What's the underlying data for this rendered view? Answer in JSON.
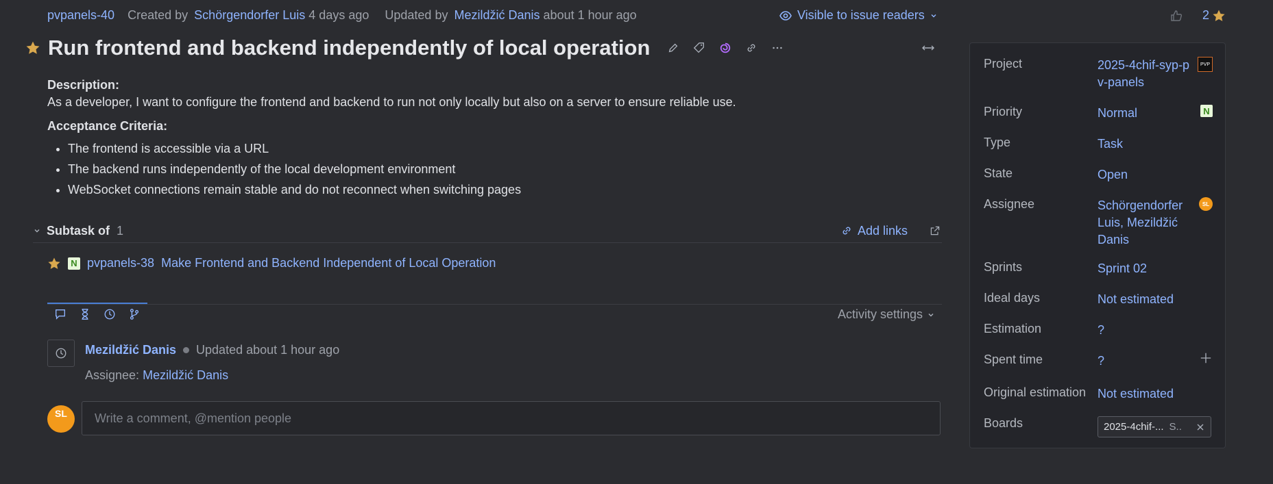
{
  "meta": {
    "issue_id": "pvpanels-40",
    "created_prefix": "Created by",
    "created_by": "Schörgendorfer Luis",
    "created_ago": "4 days ago",
    "updated_prefix": "Updated by",
    "updated_by": "Mezildžić Danis",
    "updated_ago": "about 1 hour ago",
    "visibility": "Visible to issue readers",
    "vote_count": "2"
  },
  "title": "Run frontend and backend independently of local operation",
  "description": {
    "heading": "Description:",
    "text": "As a developer, I want to configure the frontend and backend to run not only locally but also on a server to ensure reliable use.",
    "criteria_heading": "Acceptance Criteria:",
    "criteria": [
      "The frontend is accessible via a URL",
      "The backend runs independently of the local development environment",
      "WebSocket connections remain stable and do not reconnect when switching pages"
    ]
  },
  "subtask": {
    "label": "Subtask of",
    "count": "1",
    "add_links": "Add links",
    "item": {
      "badge": "N",
      "id": "pvpanels-38",
      "title": "Make Frontend and Backend Independent of Local Operation"
    }
  },
  "activity": {
    "settings_label": "Activity settings",
    "author": "Mezildžić Danis",
    "status": "Updated about 1 hour ago",
    "change_label": "Assignee:",
    "change_value": "Mezildžić Danis"
  },
  "comment": {
    "avatar_initials": "SL",
    "placeholder": "Write a comment, @mention people"
  },
  "panel": {
    "project_label": "Project",
    "project_value": "2025-4chif-syp-pv-panels",
    "priority_label": "Priority",
    "priority_value": "Normal",
    "priority_badge": "N",
    "type_label": "Type",
    "type_value": "Task",
    "state_label": "State",
    "state_value": "Open",
    "assignee_label": "Assignee",
    "assignee_value": "Schörgendorfer Luis, Mezildžić Danis",
    "assignee_initials": "SL",
    "sprints_label": "Sprints",
    "sprints_value": "Sprint 02",
    "ideal_label": "Ideal days",
    "ideal_value": "Not estimated",
    "estimation_label": "Estimation",
    "estimation_value": "?",
    "spent_label": "Spent time",
    "spent_value": "?",
    "original_label": "Original estimation",
    "original_value": "Not estimated",
    "boards_label": "Boards",
    "board_chip": "2025-4chif-...",
    "board_chip_suffix": "S.."
  },
  "colors": {
    "background": "#2b2c30",
    "link": "#8fb4ff",
    "star": "#d9a84e",
    "accent_orange": "#f39a1b"
  }
}
